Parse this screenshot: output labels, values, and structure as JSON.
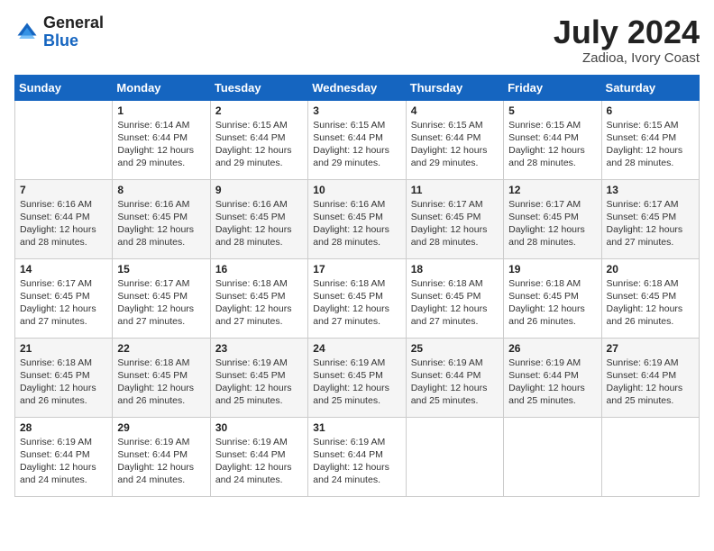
{
  "header": {
    "logo_general": "General",
    "logo_blue": "Blue",
    "month_year": "July 2024",
    "location": "Zadioa, Ivory Coast"
  },
  "weekdays": [
    "Sunday",
    "Monday",
    "Tuesday",
    "Wednesday",
    "Thursday",
    "Friday",
    "Saturday"
  ],
  "weeks": [
    [
      {
        "day": "",
        "info": ""
      },
      {
        "day": "1",
        "info": "Sunrise: 6:14 AM\nSunset: 6:44 PM\nDaylight: 12 hours\nand 29 minutes."
      },
      {
        "day": "2",
        "info": "Sunrise: 6:15 AM\nSunset: 6:44 PM\nDaylight: 12 hours\nand 29 minutes."
      },
      {
        "day": "3",
        "info": "Sunrise: 6:15 AM\nSunset: 6:44 PM\nDaylight: 12 hours\nand 29 minutes."
      },
      {
        "day": "4",
        "info": "Sunrise: 6:15 AM\nSunset: 6:44 PM\nDaylight: 12 hours\nand 29 minutes."
      },
      {
        "day": "5",
        "info": "Sunrise: 6:15 AM\nSunset: 6:44 PM\nDaylight: 12 hours\nand 28 minutes."
      },
      {
        "day": "6",
        "info": "Sunrise: 6:15 AM\nSunset: 6:44 PM\nDaylight: 12 hours\nand 28 minutes."
      }
    ],
    [
      {
        "day": "7",
        "info": "Sunrise: 6:16 AM\nSunset: 6:44 PM\nDaylight: 12 hours\nand 28 minutes."
      },
      {
        "day": "8",
        "info": "Sunrise: 6:16 AM\nSunset: 6:45 PM\nDaylight: 12 hours\nand 28 minutes."
      },
      {
        "day": "9",
        "info": "Sunrise: 6:16 AM\nSunset: 6:45 PM\nDaylight: 12 hours\nand 28 minutes."
      },
      {
        "day": "10",
        "info": "Sunrise: 6:16 AM\nSunset: 6:45 PM\nDaylight: 12 hours\nand 28 minutes."
      },
      {
        "day": "11",
        "info": "Sunrise: 6:17 AM\nSunset: 6:45 PM\nDaylight: 12 hours\nand 28 minutes."
      },
      {
        "day": "12",
        "info": "Sunrise: 6:17 AM\nSunset: 6:45 PM\nDaylight: 12 hours\nand 28 minutes."
      },
      {
        "day": "13",
        "info": "Sunrise: 6:17 AM\nSunset: 6:45 PM\nDaylight: 12 hours\nand 27 minutes."
      }
    ],
    [
      {
        "day": "14",
        "info": "Sunrise: 6:17 AM\nSunset: 6:45 PM\nDaylight: 12 hours\nand 27 minutes."
      },
      {
        "day": "15",
        "info": "Sunrise: 6:17 AM\nSunset: 6:45 PM\nDaylight: 12 hours\nand 27 minutes."
      },
      {
        "day": "16",
        "info": "Sunrise: 6:18 AM\nSunset: 6:45 PM\nDaylight: 12 hours\nand 27 minutes."
      },
      {
        "day": "17",
        "info": "Sunrise: 6:18 AM\nSunset: 6:45 PM\nDaylight: 12 hours\nand 27 minutes."
      },
      {
        "day": "18",
        "info": "Sunrise: 6:18 AM\nSunset: 6:45 PM\nDaylight: 12 hours\nand 27 minutes."
      },
      {
        "day": "19",
        "info": "Sunrise: 6:18 AM\nSunset: 6:45 PM\nDaylight: 12 hours\nand 26 minutes."
      },
      {
        "day": "20",
        "info": "Sunrise: 6:18 AM\nSunset: 6:45 PM\nDaylight: 12 hours\nand 26 minutes."
      }
    ],
    [
      {
        "day": "21",
        "info": "Sunrise: 6:18 AM\nSunset: 6:45 PM\nDaylight: 12 hours\nand 26 minutes."
      },
      {
        "day": "22",
        "info": "Sunrise: 6:18 AM\nSunset: 6:45 PM\nDaylight: 12 hours\nand 26 minutes."
      },
      {
        "day": "23",
        "info": "Sunrise: 6:19 AM\nSunset: 6:45 PM\nDaylight: 12 hours\nand 25 minutes."
      },
      {
        "day": "24",
        "info": "Sunrise: 6:19 AM\nSunset: 6:45 PM\nDaylight: 12 hours\nand 25 minutes."
      },
      {
        "day": "25",
        "info": "Sunrise: 6:19 AM\nSunset: 6:44 PM\nDaylight: 12 hours\nand 25 minutes."
      },
      {
        "day": "26",
        "info": "Sunrise: 6:19 AM\nSunset: 6:44 PM\nDaylight: 12 hours\nand 25 minutes."
      },
      {
        "day": "27",
        "info": "Sunrise: 6:19 AM\nSunset: 6:44 PM\nDaylight: 12 hours\nand 25 minutes."
      }
    ],
    [
      {
        "day": "28",
        "info": "Sunrise: 6:19 AM\nSunset: 6:44 PM\nDaylight: 12 hours\nand 24 minutes."
      },
      {
        "day": "29",
        "info": "Sunrise: 6:19 AM\nSunset: 6:44 PM\nDaylight: 12 hours\nand 24 minutes."
      },
      {
        "day": "30",
        "info": "Sunrise: 6:19 AM\nSunset: 6:44 PM\nDaylight: 12 hours\nand 24 minutes."
      },
      {
        "day": "31",
        "info": "Sunrise: 6:19 AM\nSunset: 6:44 PM\nDaylight: 12 hours\nand 24 minutes."
      },
      {
        "day": "",
        "info": ""
      },
      {
        "day": "",
        "info": ""
      },
      {
        "day": "",
        "info": ""
      }
    ]
  ]
}
